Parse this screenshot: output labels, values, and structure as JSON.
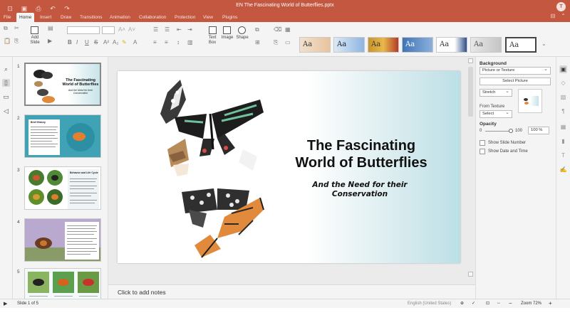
{
  "window": {
    "title": "EN The Fascinating World of Butterflies.pptx",
    "user_initial": "T"
  },
  "menu": {
    "tabs": [
      "File",
      "Home",
      "Insert",
      "Draw",
      "Transitions",
      "Animation",
      "Collaboration",
      "Protection",
      "View",
      "Plugins"
    ],
    "active": "Home"
  },
  "ribbon": {
    "add_slide": "Add\nSlide",
    "text_box": "Text\nBox",
    "image": "Image",
    "shape": "Shape",
    "theme_sample": "Aa",
    "theme_count": 8
  },
  "slides_panel": {
    "thumbs": [
      {
        "num": "1",
        "title": "The Fascinating World of Butterflies",
        "sub": "And the Need for their Conservation"
      },
      {
        "num": "2",
        "title": "Brief History"
      },
      {
        "num": "3",
        "title": "Behavior and Life Cycle"
      },
      {
        "num": "4",
        "title": ""
      },
      {
        "num": "5",
        "title": ""
      }
    ]
  },
  "slide": {
    "title": "The Fascinating\nWorld of Butterflies",
    "subtitle": "And the Need for their\nConservation"
  },
  "notes": {
    "placeholder": "Click to add notes"
  },
  "right_panel": {
    "background_heading": "Background",
    "fill_type": "Picture or Texture",
    "select_picture": "Select Picture",
    "stretch": "Stretch",
    "from_texture": "From Texture",
    "select": "Select",
    "opacity_label": "Opacity",
    "opacity_min": "0",
    "opacity_max": "100",
    "opacity_value": "100 %",
    "opacity_fraction": 1.0,
    "show_slide_number": "Show Slide Number",
    "show_date_time": "Show Date and Time"
  },
  "status": {
    "slide_of": "Slide 1 of 5",
    "language": "English (United States)",
    "zoom": "Zoom 72%"
  },
  "colors": {
    "titlebar": "#c4573f",
    "panel": "#f4f4f4"
  }
}
